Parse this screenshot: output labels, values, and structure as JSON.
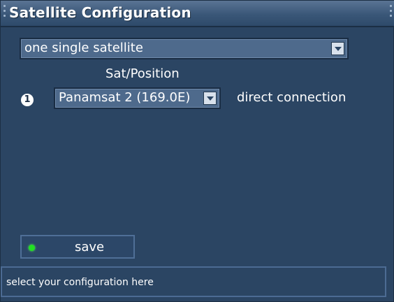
{
  "window": {
    "title": "Satellite Configuration"
  },
  "config": {
    "mode_value": "one single satellite",
    "sat_position_heading": "Sat/Position",
    "slot_number": "1",
    "satellite_value": "Panamsat 2 (169.0E)",
    "connection_label": "direct connection"
  },
  "actions": {
    "save_label": "save",
    "save_indicator_color": "#22e022"
  },
  "status": {
    "text": "select your configuration here"
  },
  "icons": {
    "dropdown_arrow": "chevron-down-icon",
    "slot_badge": "number-badge-icon",
    "indicator": "green-dot-icon"
  }
}
